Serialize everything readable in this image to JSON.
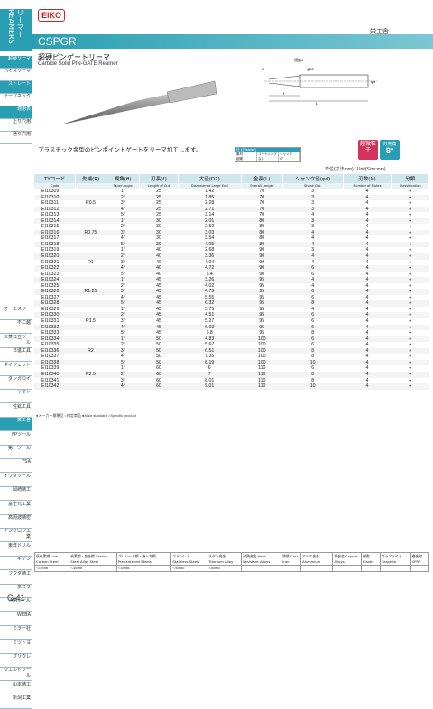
{
  "brand": {
    "logo": "EIKO",
    "maker": "栄工舎"
  },
  "sidebar": {
    "title": "リーマー REAMERS",
    "items": [
      {
        "label": "超硬リーマ",
        "sub": "",
        "active": true
      },
      {
        "label": "ハイスリーマ",
        "sub": "",
        "active": false
      },
      {
        "label": "ストレート",
        "sub": "",
        "active": true
      },
      {
        "label": "テーパネック",
        "sub": "",
        "active": false
      },
      {
        "label": "適用表",
        "sub": "",
        "active": true
      },
      {
        "label": "止り穴用",
        "sub": "",
        "active": false
      },
      {
        "label": "通り穴用",
        "sub": "",
        "active": false
      },
      {
        "label": "オーエスジー",
        "sub": "",
        "active": false
      },
      {
        "label": "不二越",
        "sub": "",
        "active": false
      },
      {
        "label": "三菱日立ツール",
        "sub": "",
        "active": false
      },
      {
        "label": "日進工具",
        "sub": "",
        "active": false
      },
      {
        "label": "ダイジェット",
        "sub": "",
        "active": false
      },
      {
        "label": "タンガロイ",
        "sub": "",
        "active": false
      },
      {
        "label": "ヤマト",
        "sub": "",
        "active": false
      },
      {
        "label": "住鉱工具",
        "sub": "",
        "active": false
      },
      {
        "label": "栄工舎",
        "sub": "",
        "active": true
      },
      {
        "label": "FPツール",
        "sub": "",
        "active": false
      },
      {
        "label": "第一ツール",
        "sub": "",
        "active": false
      },
      {
        "label": "YSA",
        "sub": "",
        "active": false
      },
      {
        "label": "イワタツール",
        "sub": "",
        "active": false
      },
      {
        "label": "岡崎精工",
        "sub": "",
        "active": false
      },
      {
        "label": "富士元工業",
        "sub": "",
        "active": false
      },
      {
        "label": "高周波精密",
        "sub": "",
        "active": false
      },
      {
        "label": "アンクロン工業",
        "sub": "",
        "active": false
      },
      {
        "label": "東洋ドリル",
        "sub": "",
        "active": false
      },
      {
        "label": "ギケン",
        "sub": "",
        "active": false
      },
      {
        "label": "フクダ精工",
        "sub": "",
        "active": false
      },
      {
        "label": "京セラ",
        "sub": "",
        "active": false
      },
      {
        "label": "MAツール",
        "sub": "",
        "active": false
      },
      {
        "label": "WEBA",
        "sub": "",
        "active": false
      },
      {
        "label": "ミラー社",
        "sub": "",
        "active": false
      },
      {
        "label": "ミツトヨ",
        "sub": "",
        "active": false
      },
      {
        "label": "ブリウレ",
        "sub": "",
        "active": false
      },
      {
        "label": "ウエルドツール",
        "sub": "",
        "active": false
      },
      {
        "label": "山本精工",
        "sub": "",
        "active": false
      },
      {
        "label": "新潟工業",
        "sub": "",
        "active": false
      }
    ]
  },
  "header": {
    "series": "CSPGR",
    "title_jp": "超硬ピンゲートリーマ",
    "title_en": "Carbide Solid PIN-GATE Reamer"
  },
  "description": "プラスチック金型のピンポイントゲートをリーマ加工します。",
  "drawing": {
    "label_angle": "規角θ",
    "label_r": "R",
    "label_d2": "φD2",
    "label_d": "φd",
    "label_l": "L",
    "label_e": "ℓ"
  },
  "coating": {
    "header": "仕上(Reamer)",
    "cols": [
      "素材",
      "コーティング",
      "シャンク"
    ],
    "vals": [
      "超硬",
      "なし",
      "h7"
    ]
  },
  "badges": {
    "b1": "超微粒子",
    "b2_label": "刃先角",
    "b2_value": "8°"
  },
  "unit": "単位(寸法mm) / Unit(Size:mm)",
  "table": {
    "headers": [
      "TYコード",
      "先端(R)",
      "規角(θ)",
      "刃長(ℓ)",
      "大径(D2)",
      "全長(L)",
      "シャンク径(φd)",
      "刃数(N)",
      "分類"
    ],
    "subheaders": [
      "Code",
      "",
      "Taper Angle",
      "Length of Cut",
      "Diameter at Large End",
      "Overall Length",
      "Shank Dia.",
      "Number of Flutes",
      "Classification"
    ],
    "rows": [
      [
        "EI10309",
        "",
        "1°",
        "25",
        "1.42",
        "70",
        "3",
        "4"
      ],
      [
        "EI10310",
        "",
        "2°",
        "25",
        "1.85",
        "70",
        "3",
        "4"
      ],
      [
        "EI10311",
        "R0.5",
        "3°",
        "25",
        "2.28",
        "70",
        "3",
        "4"
      ],
      [
        "EI10312",
        "",
        "4°",
        "25",
        "2.71",
        "70",
        "3",
        "4"
      ],
      [
        "EI10313",
        "",
        "5°",
        "25",
        "3.14",
        "70",
        "4",
        "4"
      ],
      [
        "EI10314",
        "",
        "1°",
        "30",
        "2.01",
        "80",
        "3",
        "4"
      ],
      [
        "EI10315",
        "",
        "2°",
        "30",
        "2.52",
        "80",
        "3",
        "4"
      ],
      [
        "EI10316",
        "R0.75",
        "3°",
        "30",
        "3.03",
        "80",
        "4",
        "4"
      ],
      [
        "EI10317",
        "",
        "4°",
        "30",
        "3.54",
        "80",
        "4",
        "4"
      ],
      [
        "EI10318",
        "",
        "5°",
        "30",
        "4.05",
        "80",
        "4",
        "4"
      ],
      [
        "EI10319",
        "",
        "1°",
        "40",
        "2.68",
        "90",
        "3",
        "4"
      ],
      [
        "EI10320",
        "",
        "2°",
        "40",
        "3.36",
        "90",
        "4",
        "4"
      ],
      [
        "EI10321",
        "R1",
        "3°",
        "40",
        "4.04",
        "90",
        "4",
        "4"
      ],
      [
        "EI10322",
        "",
        "4°",
        "40",
        "4.72",
        "90",
        "6",
        "4"
      ],
      [
        "EI10323",
        "",
        "5°",
        "40",
        "5.4",
        "90",
        "6",
        "4"
      ],
      [
        "EI10324",
        "",
        "1°",
        "45",
        "3.26",
        "95",
        "4",
        "4"
      ],
      [
        "EI10325",
        "",
        "2°",
        "45",
        "4.02",
        "95",
        "4",
        "4"
      ],
      [
        "EI10326",
        "R1.25",
        "3°",
        "45",
        "4.79",
        "95",
        "6",
        "4"
      ],
      [
        "EI10327",
        "",
        "4°",
        "45",
        "5.55",
        "95",
        "6",
        "4"
      ],
      [
        "EI10328",
        "",
        "5°",
        "45",
        "6.32",
        "95",
        "8",
        "4"
      ],
      [
        "EI10329",
        "",
        "1°",
        "45",
        "3.75",
        "95",
        "4",
        "4"
      ],
      [
        "EI10330",
        "",
        "2°",
        "45",
        "4.51",
        "95",
        "6",
        "4"
      ],
      [
        "EI10331",
        "R1.5",
        "3°",
        "45",
        "5.27",
        "95",
        "6",
        "4"
      ],
      [
        "EI10332",
        "",
        "4°",
        "45",
        "6.03",
        "95",
        "6",
        "4"
      ],
      [
        "EI10333",
        "",
        "5°",
        "45",
        "6.8",
        "95",
        "8",
        "4"
      ],
      [
        "EI10334",
        "",
        "1°",
        "50",
        "4.83",
        "100",
        "6",
        "4"
      ],
      [
        "EI10335",
        "",
        "2°",
        "50",
        "5.67",
        "100",
        "6",
        "4"
      ],
      [
        "EI10336",
        "R2",
        "3°",
        "50",
        "6.51",
        "100",
        "8",
        "4"
      ],
      [
        "EI10337",
        "",
        "4°",
        "50",
        "7.35",
        "100",
        "8",
        "4"
      ],
      [
        "EI10338",
        "",
        "5°",
        "50",
        "8.19",
        "100",
        "10",
        "4"
      ],
      [
        "EI10339",
        "",
        "1°",
        "60",
        "6",
        "110",
        "6",
        "4"
      ],
      [
        "EI10340",
        "R2.5",
        "2°",
        "60",
        "7",
        "110",
        "8",
        "4"
      ],
      [
        "EI10341",
        "",
        "3°",
        "60",
        "8.01",
        "110",
        "8",
        "4"
      ],
      [
        "EI10342",
        "",
        "4°",
        "60",
        "9.01",
        "110",
        "10",
        "4"
      ]
    ]
  },
  "legend": "●メーカー標準品 ○特定商品 ●Main standard ○Specific product",
  "materials": {
    "headers": [
      "低炭素鋼 Low Carbon Steel",
      "炭素鋼・合金鋼 Carbon Steel Alloy Steel",
      "プレハード鋼・焼入れ鋼 Prehardened Steels",
      "ステンレス Stainless Steels",
      "チタン合金 Titanium Alloy",
      "耐熱合金 Heat Resistant Alloys",
      "鋳鉄 Cast Iron",
      "アルミ合金 Aluminium",
      "銅合金 Copper Alloys",
      "樹脂 Plastic",
      "グラファイト Graphite",
      "複合材 CFRP"
    ],
    "grades": [
      "〜120HB",
      "〜400HB",
      "〜40HRC",
      "〜50HRC",
      "〜60HRC",
      "",
      "",
      "",
      "",
      "",
      "",
      "",
      ""
    ]
  },
  "page": "C-41"
}
